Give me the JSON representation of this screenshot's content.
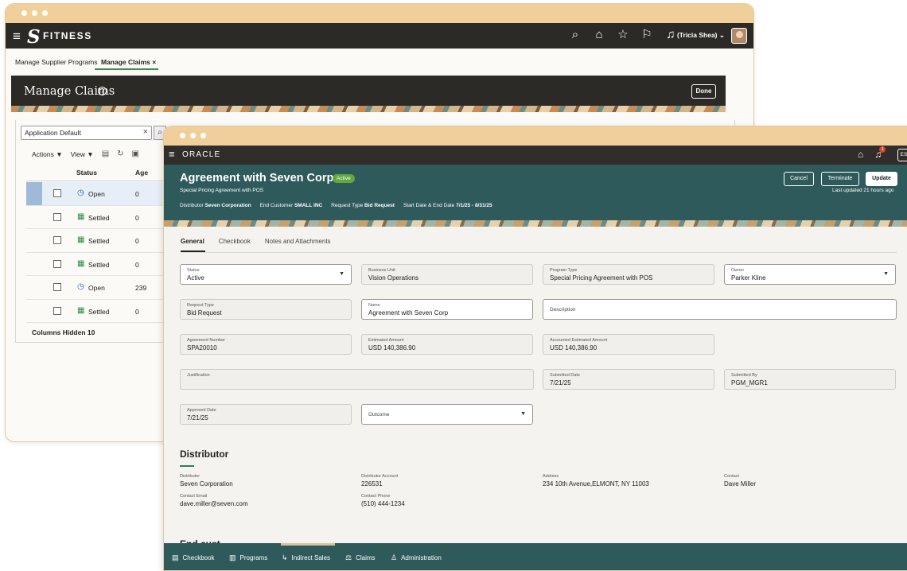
{
  "back_window": {
    "brand": "FITNESS",
    "user": "(Tricia Shea)",
    "tabs": [
      {
        "label": "Manage Supplier Programs"
      },
      {
        "label": "Manage Claims"
      }
    ],
    "tab_close": "×",
    "header": {
      "title": "Manage Claims",
      "done_label": "Done"
    },
    "search": {
      "value": "Application Default"
    },
    "toolbar": {
      "actions_label": "Actions ▼",
      "view_label": "View ▼"
    },
    "grid": {
      "col_status": "Status",
      "col_age": "Age",
      "rows": [
        {
          "status": "Open",
          "icon": "stopwatch-icon",
          "age": "0"
        },
        {
          "status": "Settled",
          "icon": "cash-icon",
          "age": "0"
        },
        {
          "status": "Settled",
          "icon": "cash-icon",
          "age": "0"
        },
        {
          "status": "Settled",
          "icon": "cash-icon",
          "age": "0"
        },
        {
          "status": "Open",
          "icon": "stopwatch-icon",
          "age": "239"
        },
        {
          "status": "Settled",
          "icon": "cash-icon",
          "age": "0"
        }
      ],
      "columns_hidden_label": "Columns Hidden",
      "columns_hidden_count": "10"
    }
  },
  "front_window": {
    "brand": "ORACLE",
    "es": "ES",
    "notif_count": "1",
    "title": "Agreement with Seven Corp",
    "status_badge": "Active",
    "subtitle": "Special Pricing Agreement with POS",
    "meta": {
      "distributor_label": "Distributor",
      "distributor_value": "Seven Corporation",
      "end_customer_label": "End Customer",
      "end_customer_value": "SMALL INC",
      "request_type_label": "Request Type",
      "request_type_value": "Bid Request",
      "dates_label": "Start Date & End Date",
      "dates_value": "7/1/25 - 8/31/25"
    },
    "buttons": {
      "cancel": "Cancel",
      "terminate": "Terminate",
      "update": "Update"
    },
    "last_updated": "Last updated 21 hours ago",
    "tabs": [
      "General",
      "Checkbook",
      "Notes and Attachments"
    ],
    "fields": {
      "status": {
        "label": "Status",
        "value": "Active"
      },
      "business_unit": {
        "label": "Business Unit",
        "value": "Vision Operations"
      },
      "program_type": {
        "label": "Program Type",
        "value": "Special Pricing Agreement with POS"
      },
      "owner": {
        "label": "Owner",
        "value": "Parker Kline"
      },
      "request_type": {
        "label": "Request Type",
        "value": "Bid Request"
      },
      "name": {
        "label": "Name",
        "value": "Agreement with Seven Corp"
      },
      "description": {
        "label": "Description"
      },
      "agreement_number": {
        "label": "Agreement Number",
        "value": "SPA20010"
      },
      "estimated_amount": {
        "label": "Estimated Amount",
        "value": "USD 140,386.90"
      },
      "accounted_estimated_amount": {
        "label": "Accounted Estimated Amount",
        "value": "USD 140,386.90"
      },
      "justification": {
        "label": "Justification"
      },
      "submitted_date": {
        "label": "Submitted Date",
        "value": "7/21/25"
      },
      "submitted_by": {
        "label": "Submitted By",
        "value": "PGM_MGR1"
      },
      "approved_date": {
        "label": "Approved Date",
        "value": "7/21/25"
      },
      "outcome": {
        "label": "Outcome"
      }
    },
    "distributor_section": {
      "title": "Distributor",
      "distributor": {
        "label": "Distributor",
        "value": "Seven Corporation"
      },
      "account": {
        "label": "Distributor Account",
        "value": "226531"
      },
      "address": {
        "label": "Address",
        "value": "234 10th Avenue,ELMONT, NY 11003"
      },
      "contact": {
        "label": "Contact",
        "value": "Dave Miller"
      },
      "email": {
        "label": "Contact Email",
        "value": "dave.miller@seven.com"
      },
      "phone": {
        "label": "Contact Phone",
        "value": "(510) 444-1234"
      }
    },
    "next_section_peek": "End cust",
    "bottom_nav": [
      "Checkbook",
      "Programs",
      "Indirect Sales",
      "Claims",
      "Administration"
    ]
  },
  "colors": {
    "back_header": "#2b2a27",
    "front_header": "#2f5a5b",
    "accent_green": "#60a83f",
    "window_chrome": "#f0cf9b"
  }
}
